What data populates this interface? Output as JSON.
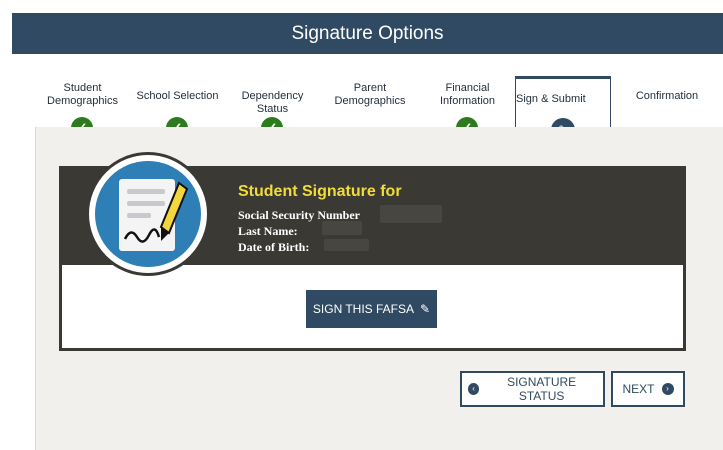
{
  "header": {
    "title": "Signature Options"
  },
  "steps": [
    {
      "label": "Student\nDemographics",
      "status": "complete"
    },
    {
      "label": "School Selection",
      "status": "complete"
    },
    {
      "label": "Dependency Status",
      "status": "complete"
    },
    {
      "label": "Parent\nDemographics",
      "status": "incomplete"
    },
    {
      "label": "Financial\nInformation",
      "status": "complete"
    },
    {
      "label": "Sign & Submit",
      "status": "active"
    },
    {
      "label": "Confirmation",
      "status": "pending"
    }
  ],
  "signature_card": {
    "title": "Student Signature for",
    "ssn_label": "Social Security Number",
    "last_name_label": "Last Name:",
    "dob_label": "Date of Birth:",
    "sign_button": "SIGN THIS FAFSA"
  },
  "actions": {
    "status_button": "SIGNATURE STATUS",
    "next_button": "NEXT"
  },
  "colors": {
    "header": "#2f4a62",
    "success": "#2e7a1e",
    "card_dark": "#3a3934",
    "title_yellow": "#f2dc3a"
  },
  "icons": {
    "check": "check-icon",
    "edit": "pencil-icon",
    "doc": "document-icon"
  }
}
